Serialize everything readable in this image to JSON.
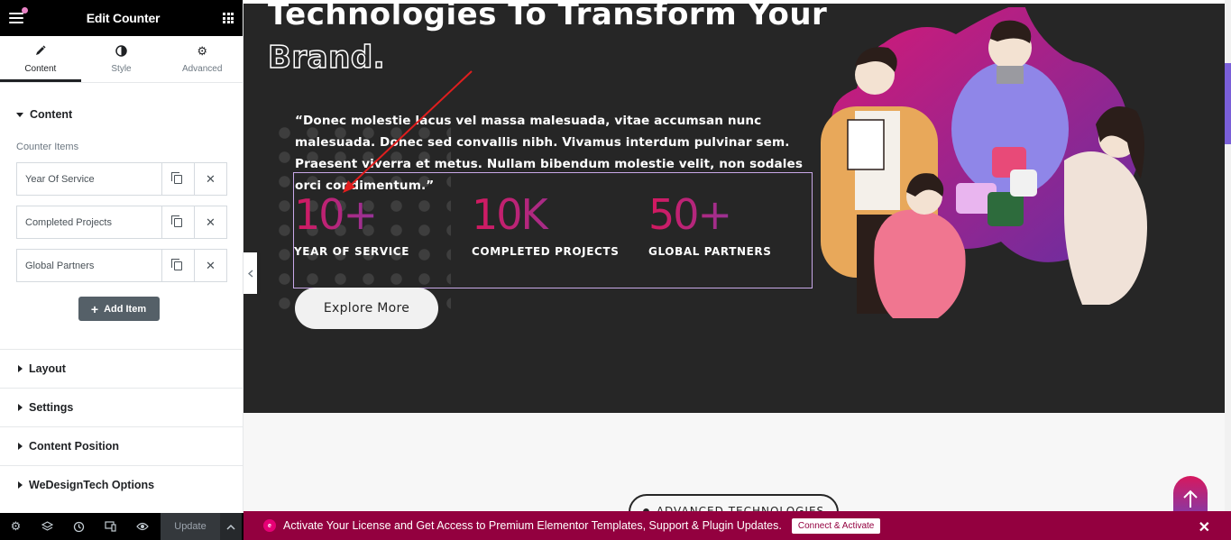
{
  "panel": {
    "title": "Edit Counter",
    "tabs": [
      {
        "label": "Content",
        "icon": "pencil-icon"
      },
      {
        "label": "Style",
        "icon": "half-circle-icon"
      },
      {
        "label": "Advanced",
        "icon": "gear-icon"
      }
    ],
    "content_section": "Content",
    "counter_items_label": "Counter Items",
    "items": [
      "Year Of Service",
      "Completed Projects",
      "Global Partners"
    ],
    "add_item": "Add Item",
    "sections": [
      "Layout",
      "Settings",
      "Content Position",
      "WeDesignTech Options"
    ],
    "footer": {
      "update": "Update"
    }
  },
  "hero": {
    "title_line1": "Technologies To Transform Your",
    "title_line2": "Brand.",
    "quote": "“Donec molestie lacus vel massa malesuada, vitae accumsan nunc malesuada. Donec sed convallis nibh. Vivamus interdum pulvinar sem. Praesent viverra et metus. Nullam bibendum molestie velit, non sodales orci condimentum.”",
    "counters": [
      {
        "value": "10+",
        "label": "YEAR OF SERVICE"
      },
      {
        "value": "10K",
        "label": "COMPLETED PROJECTS"
      },
      {
        "value": "50+",
        "label": "GLOBAL PARTNERS"
      }
    ],
    "explore_button": "Explore More"
  },
  "below": {
    "pill": "ADVANCED TECHNOLOGIES"
  },
  "license_bar": {
    "message": "Activate Your License and Get Access to Premium Elementor Templates, Support & Plugin Updates.",
    "button": "Connect & Activate"
  },
  "colors": {
    "accent_gradient_start": "#d6185e",
    "accent_gradient_end": "#7a3fb0",
    "license_bar": "#93003f",
    "dark_section": "#262626"
  }
}
